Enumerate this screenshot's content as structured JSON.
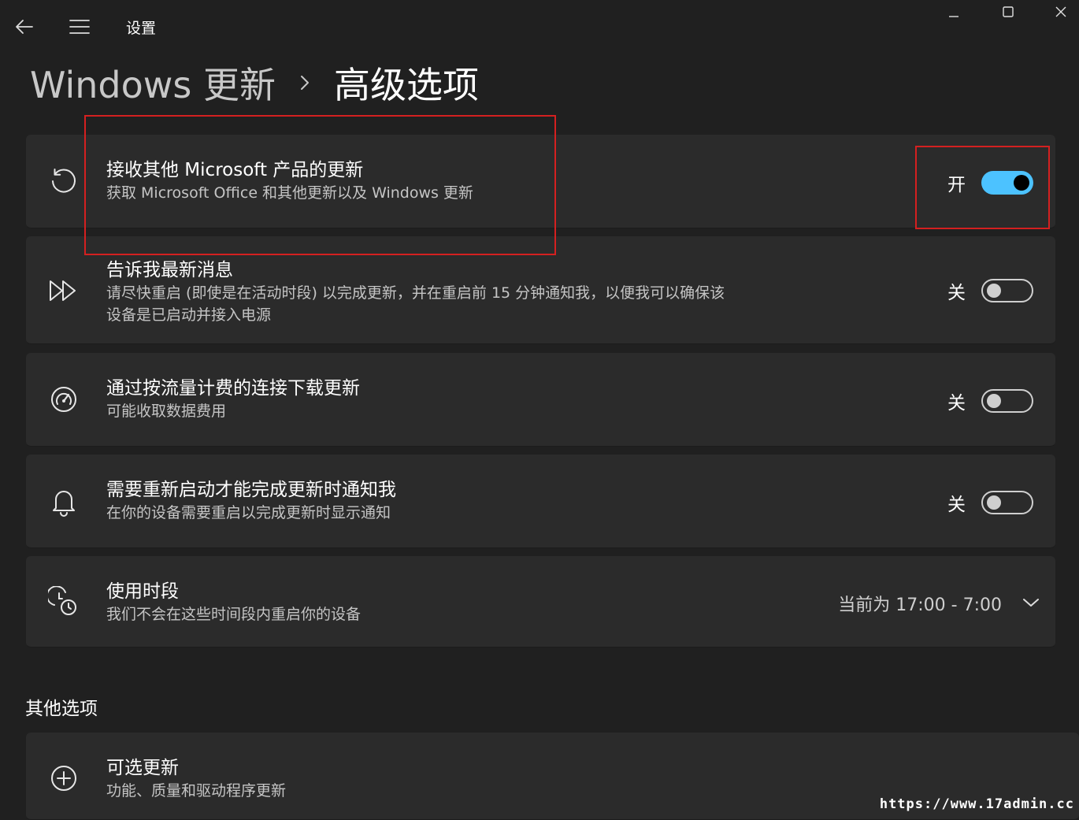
{
  "app": {
    "title": "设置"
  },
  "breadcrumb": {
    "parent": "Windows 更新",
    "current": "高级选项"
  },
  "settings": [
    {
      "title": "接收其他 Microsoft 产品的更新",
      "desc": "获取 Microsoft Office 和其他更新以及 Windows 更新",
      "state_label": "开",
      "on": true,
      "icon": "refresh-icon"
    },
    {
      "title": "告诉我最新消息",
      "desc": "请尽快重启 (即使是在活动时段) 以完成更新，并在重启前 15 分钟通知我，以便我可以确保该",
      "desc2": "设备是已启动并接入电源",
      "state_label": "关",
      "on": false,
      "icon": "fast-forward-icon"
    },
    {
      "title": "通过按流量计费的连接下载更新",
      "desc": "可能收取数据费用",
      "state_label": "关",
      "on": false,
      "icon": "gauge-icon"
    },
    {
      "title": "需要重新启动才能完成更新时通知我",
      "desc": "在你的设备需要重启以完成更新时显示通知",
      "state_label": "关",
      "on": false,
      "icon": "bell-icon"
    },
    {
      "title": "使用时段",
      "desc": "我们不会在这些时间段内重启你的设备",
      "value": "当前为 17:00 - 7:00",
      "icon": "active-hours-icon"
    }
  ],
  "other_section": {
    "title": "其他选项",
    "items": [
      {
        "title": "可选更新",
        "desc": "功能、质量和驱动程序更新",
        "icon": "plus-circle-icon"
      }
    ]
  },
  "colors": {
    "accent": "#4cc2ff",
    "highlight": "#d42020",
    "background": "#202020",
    "card": "#2b2b2b"
  },
  "watermark": "https://www.17admin.cc"
}
